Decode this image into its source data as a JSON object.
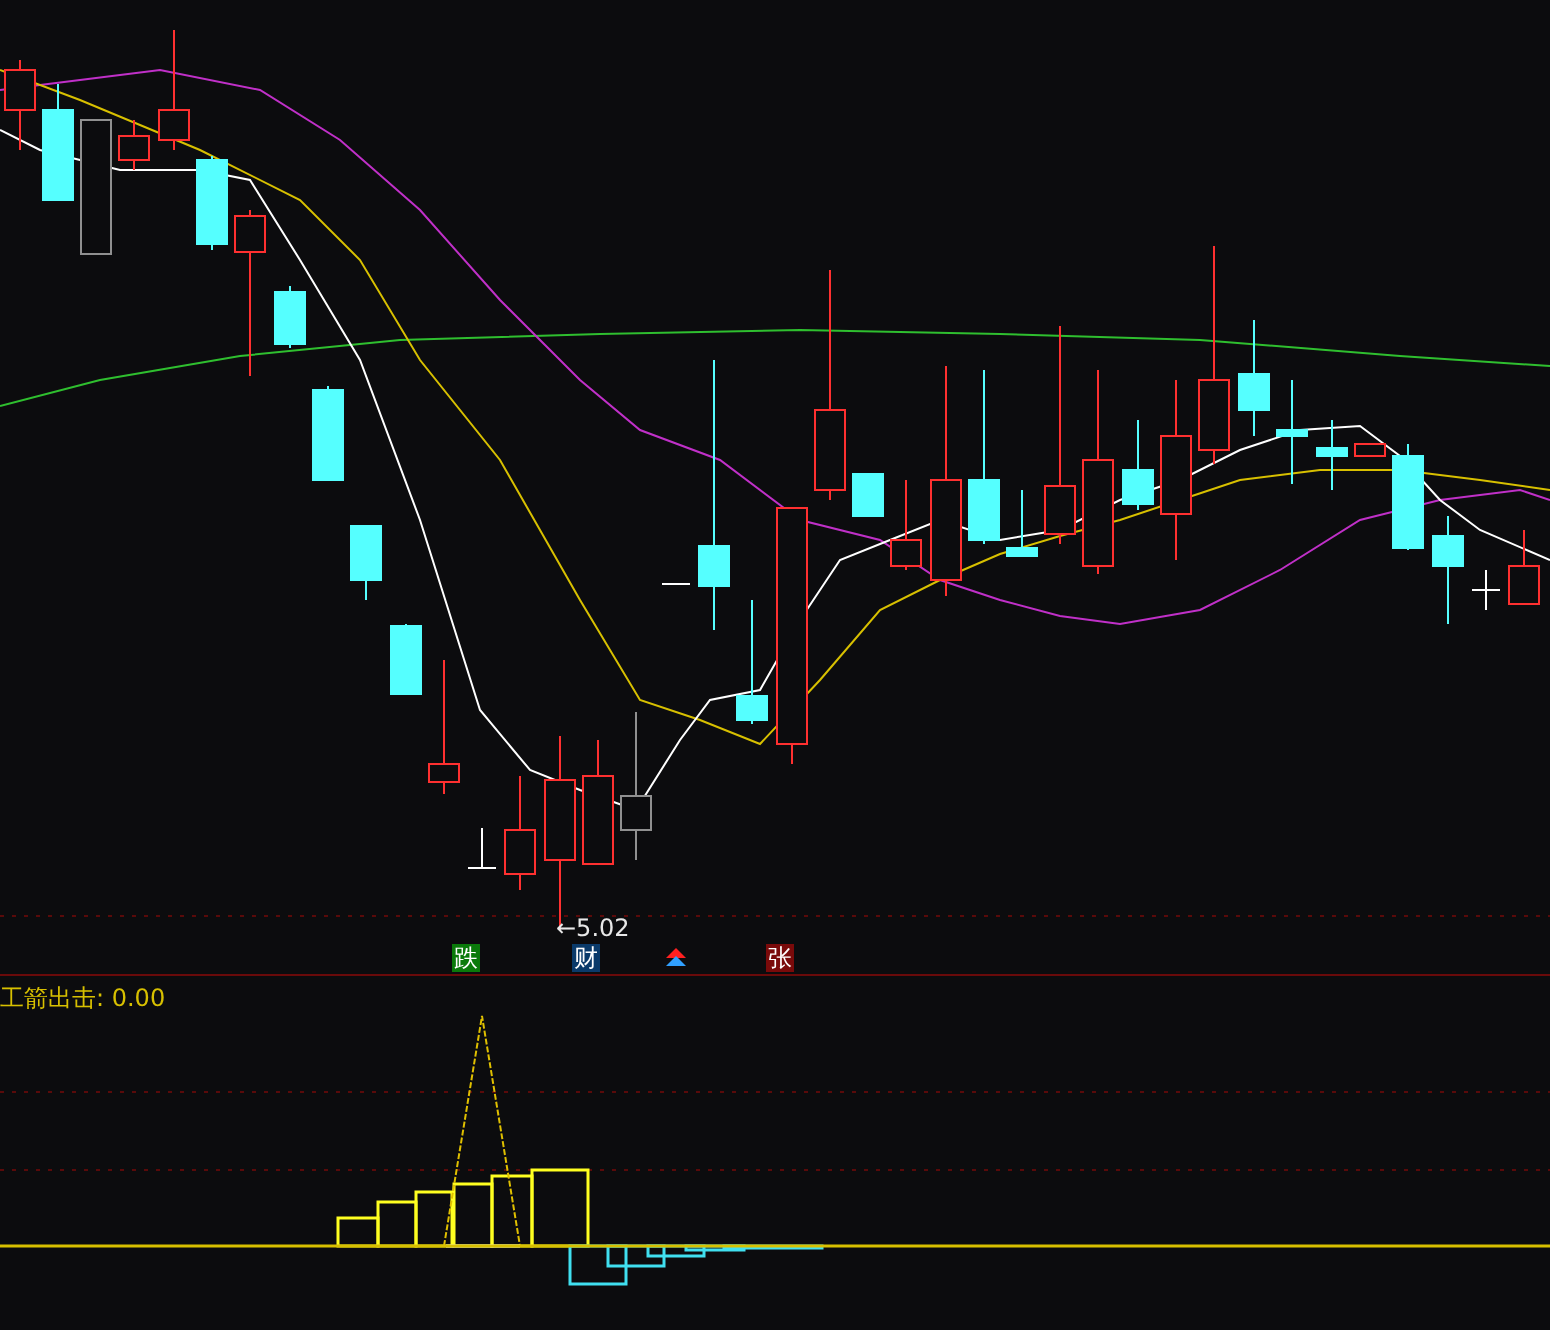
{
  "price_chart": {
    "low_price_label": "←5.02",
    "signals": [
      {
        "kind": "fall",
        "label": "跌"
      },
      {
        "kind": "finance",
        "label": "财"
      },
      {
        "kind": "arrow"
      },
      {
        "kind": "rise",
        "label": "张"
      }
    ]
  },
  "indicator": {
    "label": "工箭出击: 0.00"
  }
}
